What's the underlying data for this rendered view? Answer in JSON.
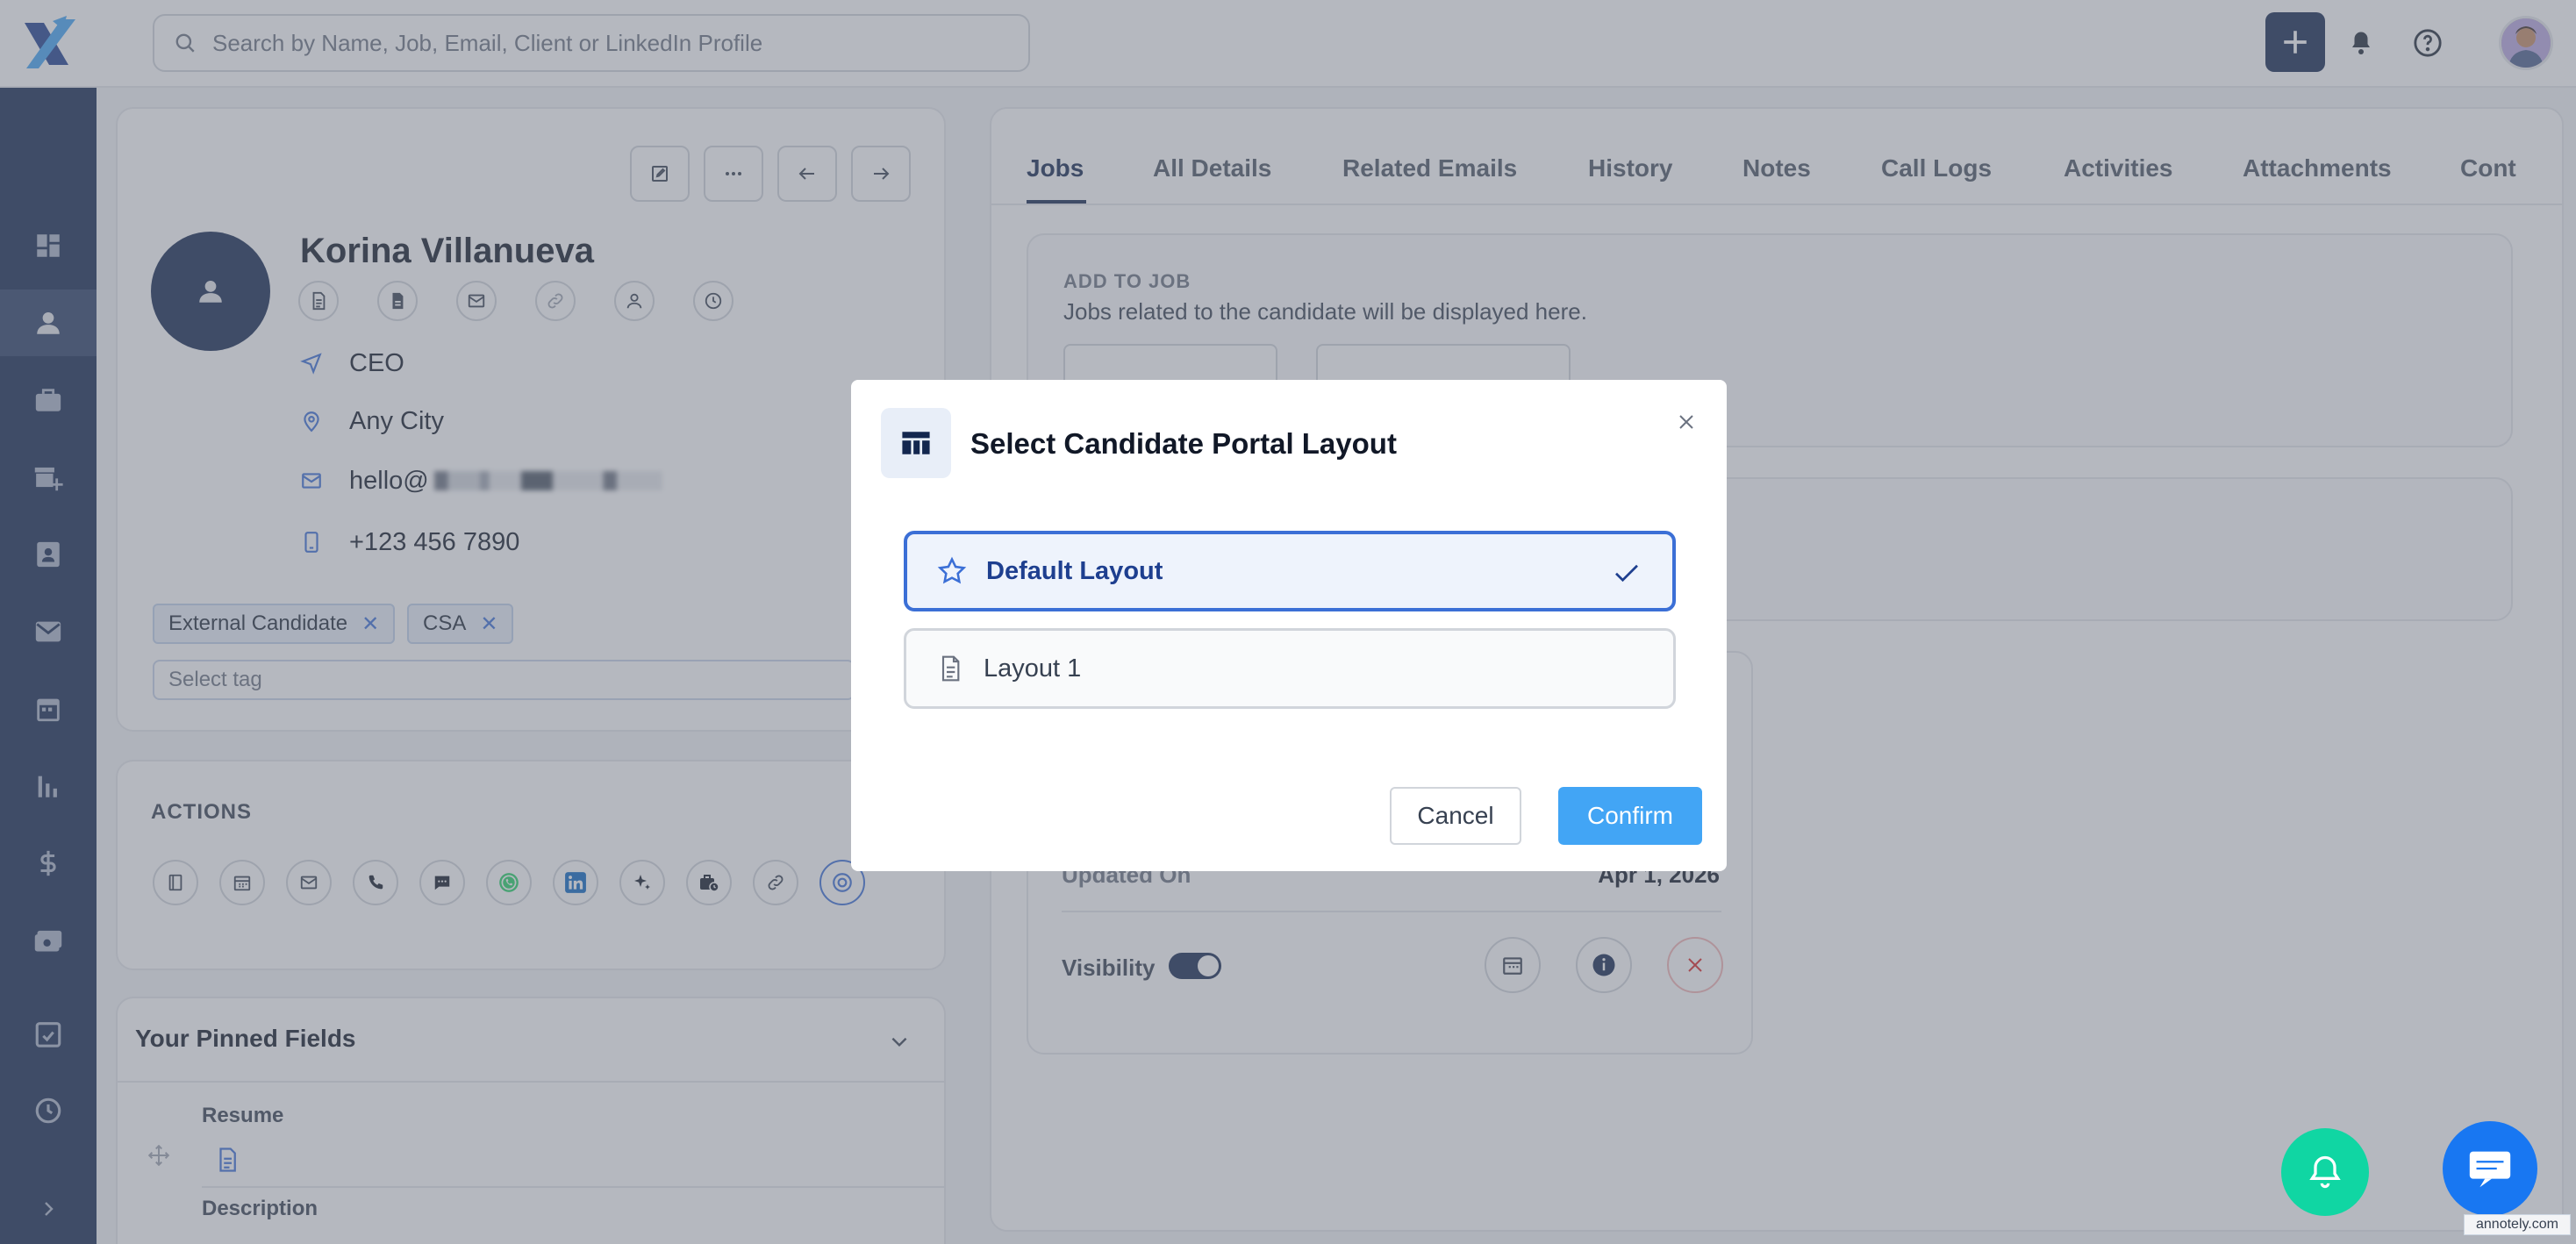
{
  "search": {
    "placeholder": "Search by Name, Job, Email, Client or LinkedIn Profile"
  },
  "candidate": {
    "name": "Korina Villanueva",
    "title": "CEO",
    "location": "Any City",
    "email": "hello@",
    "phone": "+123 456 7890",
    "tags": [
      "External Candidate",
      "CSA"
    ],
    "tag_placeholder": "Select tag"
  },
  "actions": {
    "heading": "ACTIONS"
  },
  "pinned": {
    "heading": "Your Pinned Fields",
    "fields": [
      "Resume",
      "Description"
    ]
  },
  "tabs": [
    "Jobs",
    "All Details",
    "Related Emails",
    "History",
    "Notes",
    "Call Logs",
    "Activities",
    "Attachments",
    "Cont"
  ],
  "jobs_panel": {
    "add_to_job_label": "ADD TO JOB",
    "add_to_job_desc": "Jobs related to the candidate will be displayed here.",
    "updated_on_label": "Updated On",
    "updated_on_value": "Apr 1, 2026",
    "visibility_label": "Visibility",
    "visibility_on": true
  },
  "modal": {
    "title": "Select Candidate Portal Layout",
    "options": [
      {
        "label": "Default Layout",
        "icon": "star-icon",
        "selected": true
      },
      {
        "label": "Layout 1",
        "icon": "document-icon",
        "selected": false
      }
    ],
    "cancel_label": "Cancel",
    "confirm_label": "Confirm"
  },
  "watermark": "annotely.com",
  "colors": {
    "navy": "#13274f",
    "accent_blue": "#3b6fd6",
    "confirm_blue": "#42a5f5",
    "fab_green": "#10d6a3",
    "fab_blue": "#1877f2"
  }
}
